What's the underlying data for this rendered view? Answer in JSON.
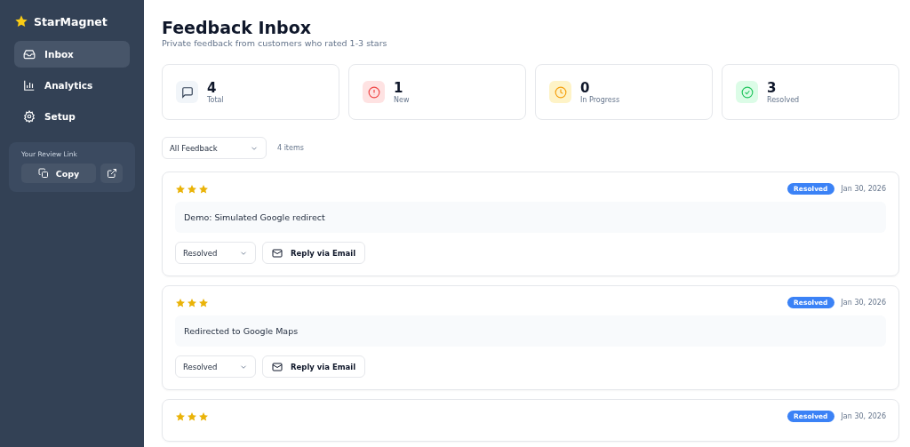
{
  "brand": {
    "name": "StarMagnet"
  },
  "sidebar": {
    "items": [
      {
        "label": "Inbox",
        "kind": "inbox",
        "selected": true
      },
      {
        "label": "Analytics",
        "kind": "chart",
        "selected": false
      },
      {
        "label": "Setup",
        "kind": "gear",
        "selected": false
      }
    ],
    "review_link": {
      "label": "Your Review Link",
      "copy_button": "Copy"
    }
  },
  "header": {
    "title": "Feedback Inbox",
    "subtitle": "Private feedback from customers who rated 1-3 stars"
  },
  "stats": [
    {
      "kind": "total",
      "value": "4",
      "label": "Total"
    },
    {
      "kind": "new",
      "value": "1",
      "label": "New"
    },
    {
      "kind": "progress",
      "value": "0",
      "label": "In Progress"
    },
    {
      "kind": "resolved",
      "value": "3",
      "label": "Resolved"
    }
  ],
  "filter": {
    "value": "All Feedback",
    "count": "4 items"
  },
  "feedback": [
    {
      "stars": 3,
      "status": "Resolved",
      "date": "Jan 30, 2026",
      "text": "Demo: Simulated Google redirect",
      "status_select": "Resolved",
      "reply_button": "Reply via Email"
    },
    {
      "stars": 3,
      "status": "Resolved",
      "date": "Jan 30, 2026",
      "text": "Redirected to Google Maps",
      "status_select": "Resolved",
      "reply_button": "Reply via Email"
    },
    {
      "stars": 3,
      "status": "Resolved",
      "date": "Jan 30, 2026"
    }
  ]
}
